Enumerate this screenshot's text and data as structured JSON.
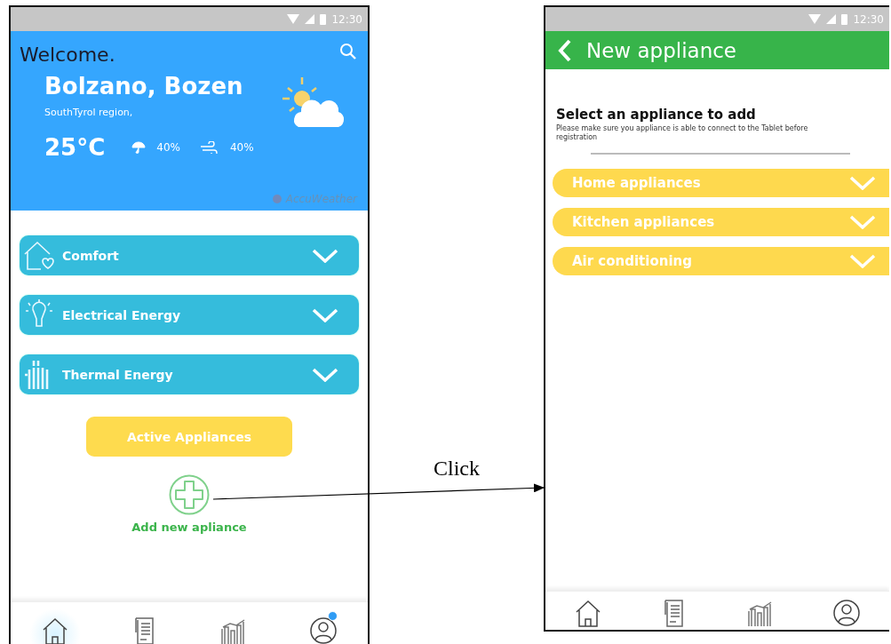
{
  "home_screen": {
    "status_bar": {
      "time": "12:30"
    },
    "header": {
      "greeting": "Welcome.",
      "city": "Bolzano, Bozen",
      "region": "SouthTyrol region,",
      "temperature": "25°C",
      "rain": "40%",
      "wind": "40%",
      "provider": "AccuWeather"
    },
    "categories": [
      {
        "kind": "comfort",
        "label": "Comfort",
        "expanded": false
      },
      {
        "kind": "electrical",
        "label": "Electrical Energy",
        "expanded": false
      },
      {
        "kind": "thermal",
        "label": "Thermal Energy",
        "expanded": false
      }
    ],
    "active_button": "Active Appliances",
    "add_label": "Add new apliance",
    "nav": [
      {
        "kind": "home",
        "selected": true,
        "badge": false
      },
      {
        "kind": "document",
        "selected": false,
        "badge": false
      },
      {
        "kind": "chart",
        "selected": false,
        "badge": false
      },
      {
        "kind": "profile",
        "selected": false,
        "badge": true
      }
    ]
  },
  "annotation": {
    "label": "Click"
  },
  "new_appliance_screen": {
    "status_bar": {
      "time": "12:30"
    },
    "title": "New appliance",
    "heading": "Select an appliance to add",
    "note": "Please make sure you appliance is able to connect to the Tablet before registration",
    "groups": [
      {
        "label": "Home appliances",
        "expanded": false
      },
      {
        "label": "Kitchen appliances",
        "expanded": false
      },
      {
        "label": "Air conditioning",
        "expanded": false
      }
    ],
    "nav": [
      {
        "kind": "home",
        "selected": false,
        "badge": false
      },
      {
        "kind": "document",
        "selected": false,
        "badge": false
      },
      {
        "kind": "chart",
        "selected": false,
        "badge": false
      },
      {
        "kind": "profile",
        "selected": false,
        "badge": false
      }
    ]
  }
}
